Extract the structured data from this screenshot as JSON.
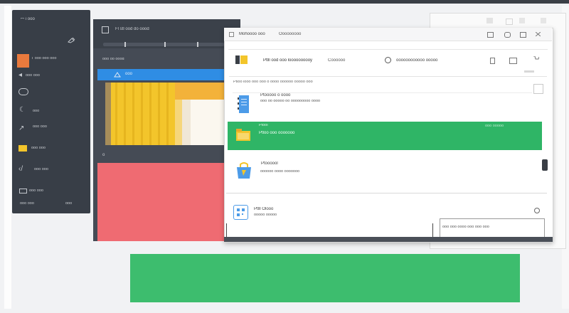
{
  "sidebar": {
    "header_text": "ꟷ  ℹ  ooo",
    "items": [
      {
        "label": "T ooo ooo ooo"
      },
      {
        "label": "ooo ooo"
      },
      {
        "label": "ooo"
      },
      {
        "label": "ooo ooo"
      },
      {
        "label": "ooo ooo"
      },
      {
        "label": "ooo ooo"
      },
      {
        "label": "ooo ooo"
      }
    ],
    "footer_left": "ooo ooo",
    "footer_right": "ooo"
  },
  "mid_window": {
    "title": "Fl stl ood do oood",
    "filter_text": "ooo oo oood",
    "selected_item": "ooo",
    "footer_text": "o"
  },
  "front_window": {
    "tab_active": "Mohoooo ooo",
    "tab_other": "Ooooooooo",
    "section1_title": "Ptlll ood ooo loooooooooy",
    "section1_sub": "Coooooo",
    "section1_right": "oooooooooooo ooooo",
    "search_placeholder": "Ptloo looo ooo ooo o oooo oooooo ooooo ooo",
    "item1_title": "Ptooooo o oooo",
    "item1_sub": "ooo oo ooooo oo ooooooooo oooo",
    "item2_title": "Ptool",
    "item2_sub": "Ptloo ooo ooooooo",
    "item2_right": "ooo ooooo",
    "item3_title": "Ptoooool",
    "item3_sub": "oooooo oooo ooooooo",
    "bottom_card_title": "Ptlll Olooo",
    "bottom_card_sub": "ooooo ooooo",
    "bottom_right_text": "ooo ooo oooo ooo ooo ooo"
  },
  "colors": {
    "accent_blue": "#2f8de4",
    "accent_green": "#2fb566",
    "accent_red": "#ef6b72",
    "accent_orange": "#ea7a3d",
    "accent_yellow": "#f3c52b"
  }
}
